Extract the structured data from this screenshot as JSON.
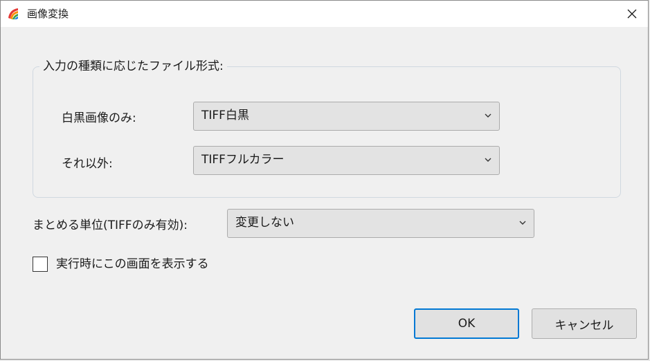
{
  "window": {
    "title": "画像変換",
    "close_icon": "close-icon",
    "app_icon": "app-logo-icon",
    "accent_color": "#0078d4"
  },
  "group": {
    "legend": "入力の種類に応じたファイル形式:",
    "bw_label": "白黒画像のみ:",
    "bw_value": "TIFF白黒",
    "other_label": "それ以外:",
    "other_value": "TIFFフルカラー"
  },
  "unit": {
    "label": "まとめる単位(TIFFのみ有効):",
    "value": "変更しない"
  },
  "show_on_run": {
    "label": "実行時にこの画面を表示する",
    "checked": false
  },
  "buttons": {
    "ok": "OK",
    "cancel": "キャンセル"
  }
}
